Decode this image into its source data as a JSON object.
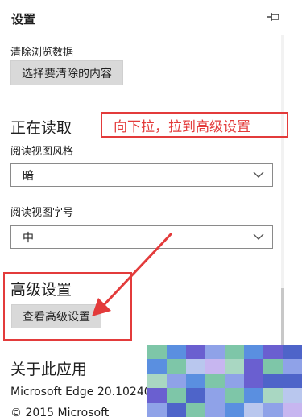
{
  "header": {
    "title": "设置",
    "pin_icon": "pin-icon"
  },
  "clear_data": {
    "label": "清除浏览数据",
    "button": "选择要清除的内容"
  },
  "reading": {
    "title": "正在读取",
    "style_label": "阅读视图风格",
    "style_value": "暗",
    "font_label": "阅读视图字号",
    "font_value": "中"
  },
  "advanced": {
    "title": "高级设置",
    "button": "查看高级设置"
  },
  "about": {
    "title": "关于此应用",
    "version": "Microsoft Edge 20.10240.1",
    "copyright": "© 2015 Microsoft"
  },
  "annotation": {
    "text": "向下拉，拉到高级设置",
    "color": "#e33b3b"
  },
  "colors": {
    "mosaic": [
      "#6a5fd0",
      "#8fa2e8",
      "#b9c7ee",
      "#7ec6a8",
      "#5a8fe0",
      "#a9d7c2",
      "#c7b6f0",
      "#4e64c9"
    ]
  }
}
